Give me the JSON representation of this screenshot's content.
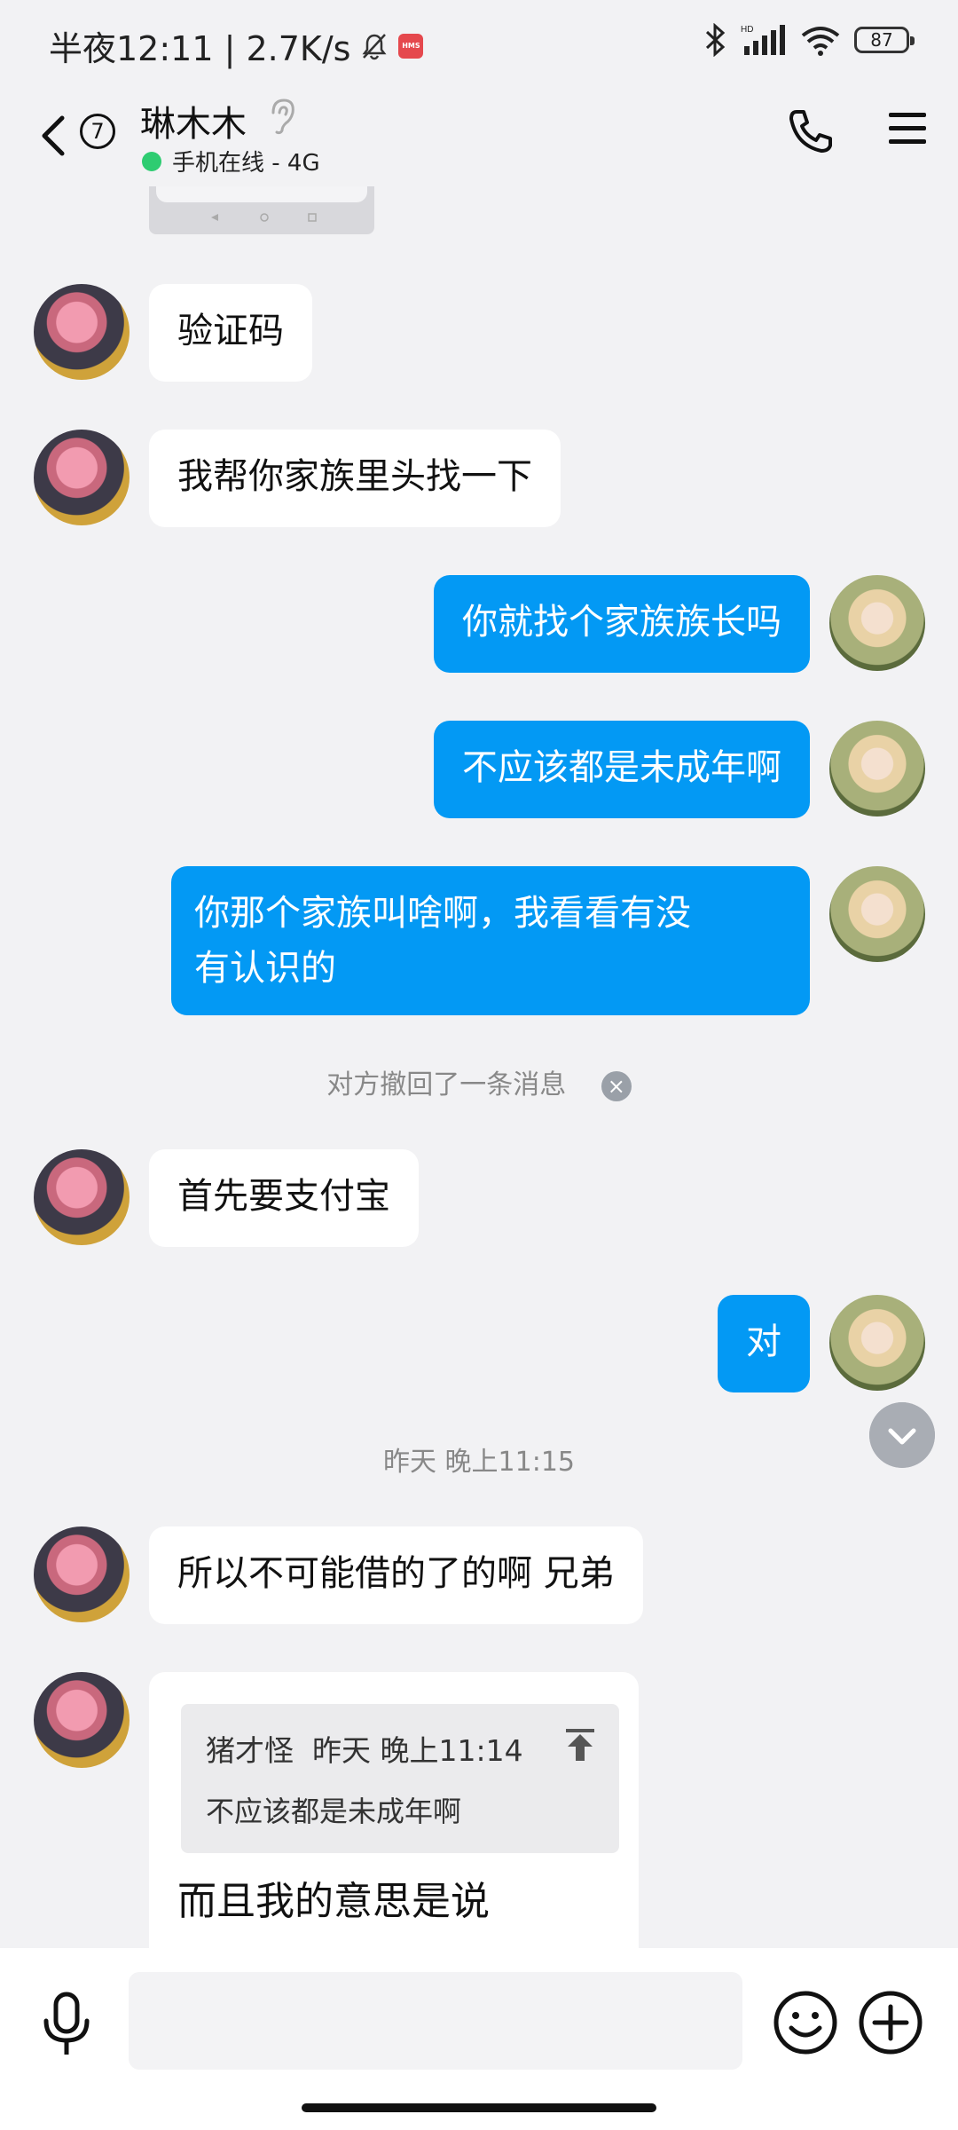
{
  "status_bar": {
    "time_speed": "半夜12:11 | 2.7K/s",
    "battery": "87"
  },
  "header": {
    "unread_count": "7",
    "title": "琳木木",
    "status": "手机在线 - 4G"
  },
  "messages": [
    {
      "side": "in",
      "text": "验证码"
    },
    {
      "side": "in",
      "text": "我帮你家族里头找一下"
    },
    {
      "side": "out",
      "text": "你就找个家族族长吗"
    },
    {
      "side": "out",
      "text": "不应该都是未成年啊"
    },
    {
      "side": "out",
      "text": "你那个家族叫啥啊，我看看有没\n有认识的"
    },
    {
      "side": "system",
      "text": "对方撤回了一条消息"
    },
    {
      "side": "in",
      "text": "首先要支付宝"
    },
    {
      "side": "out",
      "text": "对"
    },
    {
      "side": "time",
      "text": "昨天 晚上11:15"
    },
    {
      "side": "in",
      "text": "所以不可能借的了的啊 兄弟"
    },
    {
      "side": "in_quote",
      "quote_header": "猪才怪  昨天 晚上11:14",
      "quote_text": "不应该都是未成年啊",
      "text": "而且我的意思是说"
    }
  ],
  "input": {
    "placeholder": ""
  },
  "colors": {
    "outgoing_bubble": "#0399f4",
    "incoming_bubble": "#ffffff",
    "background": "#f2f2f4",
    "online": "#2ecc71"
  }
}
